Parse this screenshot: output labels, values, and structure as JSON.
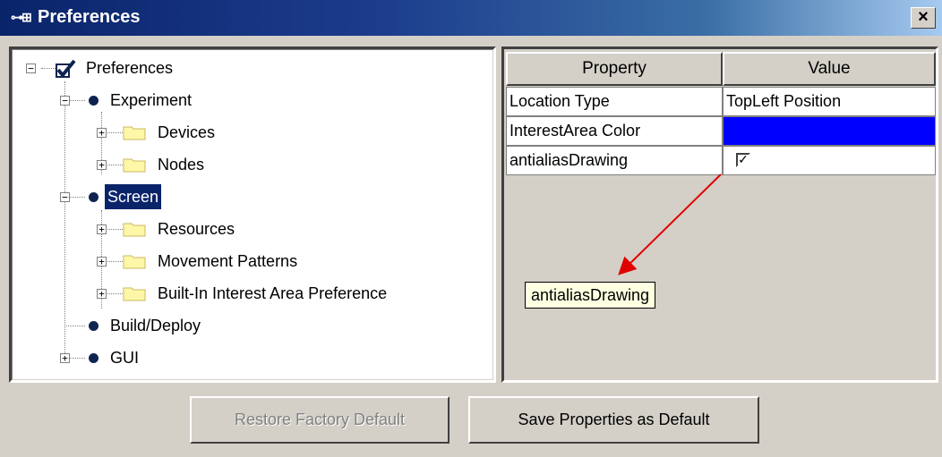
{
  "window": {
    "title": "Preferences",
    "title_icon": "network-icon",
    "close_label": "×"
  },
  "tree": {
    "root": "Preferences",
    "experiment": "Experiment",
    "devices": "Devices",
    "nodes": "Nodes",
    "screen": "Screen",
    "resources": "Resources",
    "movement_patterns": "Movement Patterns",
    "builtin_interest_area": "Built-In Interest Area Preference",
    "build_deploy": "Build/Deploy",
    "gui": "GUI",
    "expand_symbol": "+",
    "collapse_symbol": "−"
  },
  "table": {
    "headers": [
      "Property",
      "Value"
    ],
    "rows": [
      {
        "property": "Location Type",
        "value": "TopLeft Position"
      },
      {
        "property": "InterestArea Color",
        "value": "",
        "color": "#0000ff"
      },
      {
        "property": "antialiasDrawing",
        "value": "",
        "checked": true
      }
    ],
    "check_mark": "✓"
  },
  "tooltip": "antialiasDrawing",
  "buttons": {
    "restore": "Restore Factory Default",
    "save": "Save Properties as Default"
  },
  "colors": {
    "selection": "#0a246a",
    "annotation_arrow": "#e00000",
    "title_bar": "#0a246a"
  }
}
